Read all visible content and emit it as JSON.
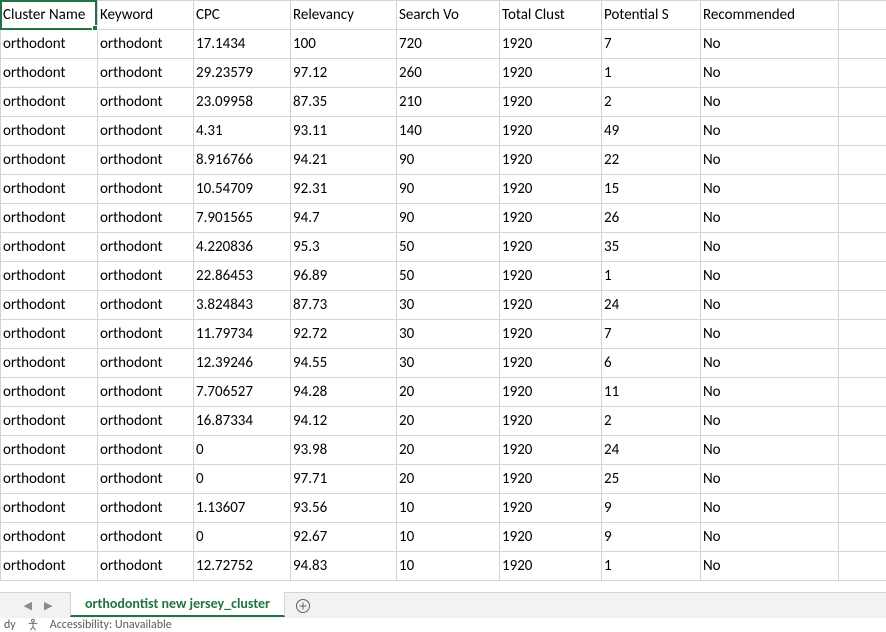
{
  "headers": {
    "a": "Cluster Name",
    "b": "Keyword",
    "c": "CPC",
    "d": "Relevancy",
    "e": "Search Vo",
    "f": "Total Clust",
    "g": "Potential S",
    "h": "Recommended"
  },
  "rows": [
    {
      "a": "orthodont",
      "b": "orthodont",
      "c": "17.1434",
      "d": "100",
      "e": "720",
      "f": "1920",
      "g": "7",
      "h": "No"
    },
    {
      "a": "orthodont",
      "b": "orthodont",
      "c": "29.23579",
      "d": "97.12",
      "e": "260",
      "f": "1920",
      "g": "1",
      "h": "No"
    },
    {
      "a": "orthodont",
      "b": "orthodont",
      "c": "23.09958",
      "d": "87.35",
      "e": "210",
      "f": "1920",
      "g": "2",
      "h": "No"
    },
    {
      "a": "orthodont",
      "b": "orthodont",
      "c": "4.31",
      "d": "93.11",
      "e": "140",
      "f": "1920",
      "g": "49",
      "h": "No"
    },
    {
      "a": "orthodont",
      "b": "orthodont",
      "c": "8.916766",
      "d": "94.21",
      "e": "90",
      "f": "1920",
      "g": "22",
      "h": "No"
    },
    {
      "a": "orthodont",
      "b": "orthodont",
      "c": "10.54709",
      "d": "92.31",
      "e": "90",
      "f": "1920",
      "g": "15",
      "h": "No"
    },
    {
      "a": "orthodont",
      "b": "orthodont",
      "c": "7.901565",
      "d": "94.7",
      "e": "90",
      "f": "1920",
      "g": "26",
      "h": "No"
    },
    {
      "a": "orthodont",
      "b": "orthodont",
      "c": "4.220836",
      "d": "95.3",
      "e": "50",
      "f": "1920",
      "g": "35",
      "h": "No"
    },
    {
      "a": "orthodont",
      "b": "orthodont",
      "c": "22.86453",
      "d": "96.89",
      "e": "50",
      "f": "1920",
      "g": "1",
      "h": "No"
    },
    {
      "a": "orthodont",
      "b": "orthodont",
      "c": "3.824843",
      "d": "87.73",
      "e": "30",
      "f": "1920",
      "g": "24",
      "h": "No"
    },
    {
      "a": "orthodont",
      "b": "orthodont",
      "c": "11.79734",
      "d": "92.72",
      "e": "30",
      "f": "1920",
      "g": "7",
      "h": "No"
    },
    {
      "a": "orthodont",
      "b": "orthodont",
      "c": "12.39246",
      "d": "94.55",
      "e": "30",
      "f": "1920",
      "g": "6",
      "h": "No"
    },
    {
      "a": "orthodont",
      "b": "orthodont",
      "c": "7.706527",
      "d": "94.28",
      "e": "20",
      "f": "1920",
      "g": "11",
      "h": "No"
    },
    {
      "a": "orthodont",
      "b": "orthodont",
      "c": "16.87334",
      "d": "94.12",
      "e": "20",
      "f": "1920",
      "g": "2",
      "h": "No"
    },
    {
      "a": "orthodont",
      "b": "orthodont",
      "c": "0",
      "d": "93.98",
      "e": "20",
      "f": "1920",
      "g": "24",
      "h": "No"
    },
    {
      "a": "orthodont",
      "b": "orthodont",
      "c": "0",
      "d": "97.71",
      "e": "20",
      "f": "1920",
      "g": "25",
      "h": "No"
    },
    {
      "a": "orthodont",
      "b": "orthodont",
      "c": "1.13607",
      "d": "93.56",
      "e": "10",
      "f": "1920",
      "g": "9",
      "h": "No"
    },
    {
      "a": "orthodont",
      "b": "orthodont",
      "c": "0",
      "d": "92.67",
      "e": "10",
      "f": "1920",
      "g": "9",
      "h": "No"
    },
    {
      "a": "orthodont",
      "b": "orthodont",
      "c": "12.72752",
      "d": "94.83",
      "e": "10",
      "f": "1920",
      "g": "1",
      "h": "No"
    }
  ],
  "tab": {
    "name": "orthodontist new jersey_cluster"
  },
  "status": {
    "ready": "dy",
    "accessibility": "Accessibility: Unavailable"
  }
}
